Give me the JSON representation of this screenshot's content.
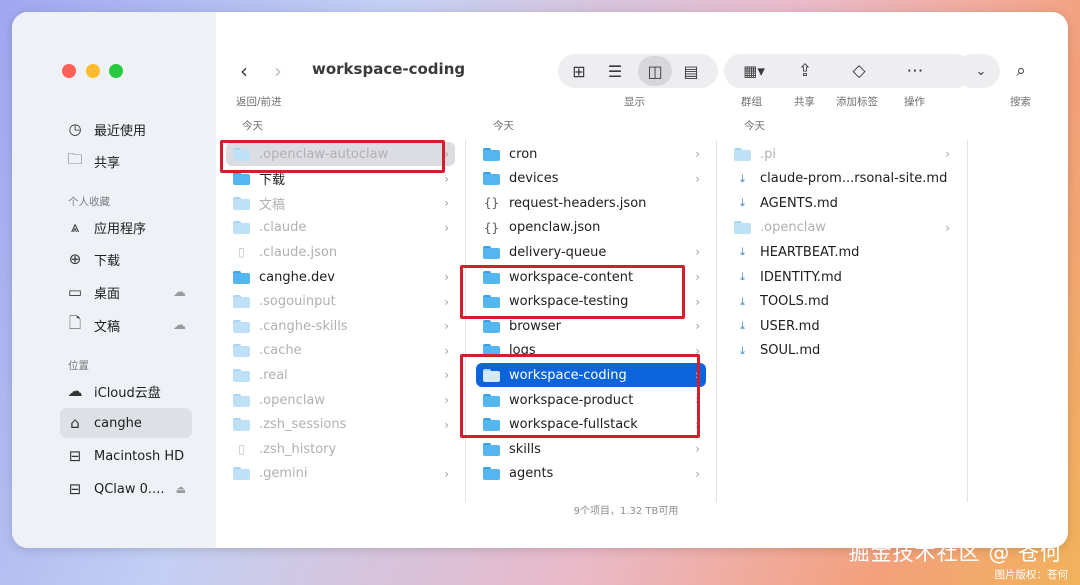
{
  "window": {
    "title": "workspace-coding"
  },
  "toolbar": {
    "back_forward_label": "返回/前进",
    "view_label": "显示",
    "group_label": "群组",
    "share_label": "共享",
    "tags_label": "添加标签",
    "action_label": "操作",
    "search_label": "搜索"
  },
  "sidebar": {
    "items": [
      {
        "label": "最近使用",
        "icon": "clock-icon"
      },
      {
        "label": "共享",
        "icon": "shared-folder-icon"
      }
    ],
    "favorites_header": "个人收藏",
    "favorites": [
      {
        "label": "应用程序",
        "icon": "applications-icon"
      },
      {
        "label": "下载",
        "icon": "download-icon"
      },
      {
        "label": "桌面",
        "icon": "desktop-icon",
        "cloud": true
      },
      {
        "label": "文稿",
        "icon": "document-icon",
        "cloud": true
      }
    ],
    "locations_header": "位置",
    "locations": [
      {
        "label": "iCloud云盘",
        "icon": "cloud-icon"
      },
      {
        "label": "canghe",
        "icon": "home-icon",
        "selected": true
      },
      {
        "label": "Macintosh HD",
        "icon": "disk-icon"
      },
      {
        "label": "QClaw 0....",
        "icon": "disk-icon",
        "eject": true
      }
    ]
  },
  "columns": [
    {
      "header": "今天",
      "rows": [
        {
          "name": ".openclaw-autoclaw",
          "type": "folder",
          "dim": true,
          "highlighted": true,
          "chevron": true
        },
        {
          "name": "下载",
          "type": "folder",
          "chevron": true
        },
        {
          "name": "文稿",
          "type": "folder",
          "dim": true,
          "chevron": true
        },
        {
          "name": ".claude",
          "type": "folder",
          "dim": true,
          "chevron": true
        },
        {
          "name": ".claude.json",
          "type": "file",
          "dim": true
        },
        {
          "name": "canghe.dev",
          "type": "folder",
          "chevron": true
        },
        {
          "name": ".sogouinput",
          "type": "folder",
          "dim": true,
          "chevron": true
        },
        {
          "name": ".canghe-skills",
          "type": "folder",
          "dim": true,
          "chevron": true
        },
        {
          "name": ".cache",
          "type": "folder",
          "dim": true,
          "chevron": true
        },
        {
          "name": ".real",
          "type": "folder",
          "dim": true,
          "chevron": true
        },
        {
          "name": ".openclaw",
          "type": "folder",
          "dim": true,
          "chevron": true
        },
        {
          "name": ".zsh_sessions",
          "type": "folder",
          "dim": true,
          "chevron": true
        },
        {
          "name": ".zsh_history",
          "type": "file",
          "dim": true
        },
        {
          "name": ".gemini",
          "type": "folder",
          "dim": true,
          "chevron": true
        }
      ]
    },
    {
      "header": "今天",
      "rows": [
        {
          "name": "cron",
          "type": "folder",
          "chevron": true
        },
        {
          "name": "devices",
          "type": "folder",
          "chevron": true
        },
        {
          "name": "request-headers.json",
          "type": "json"
        },
        {
          "name": "openclaw.json",
          "type": "json"
        },
        {
          "name": "delivery-queue",
          "type": "folder",
          "chevron": true
        },
        {
          "name": "workspace-content",
          "type": "folder",
          "chevron": true
        },
        {
          "name": "workspace-testing",
          "type": "folder",
          "chevron": true
        },
        {
          "name": "browser",
          "type": "folder",
          "chevron": true
        },
        {
          "name": "logs",
          "type": "folder",
          "chevron": true
        },
        {
          "name": "workspace-coding",
          "type": "folder",
          "selected": true,
          "chevron": true
        },
        {
          "name": "workspace-product",
          "type": "folder",
          "chevron": true
        },
        {
          "name": "workspace-fullstack",
          "type": "folder",
          "chevron": true
        },
        {
          "name": "skills",
          "type": "folder",
          "chevron": true
        },
        {
          "name": "agents",
          "type": "folder",
          "chevron": true
        }
      ]
    },
    {
      "header": "今天",
      "rows": [
        {
          "name": ".pi",
          "type": "folder",
          "dim": true,
          "chevron": true
        },
        {
          "name": "claude-prom...rsonal-site.md",
          "type": "md"
        },
        {
          "name": "AGENTS.md",
          "type": "md"
        },
        {
          "name": ".openclaw",
          "type": "folder",
          "dim": true,
          "chevron": true
        },
        {
          "name": "HEARTBEAT.md",
          "type": "md"
        },
        {
          "name": "IDENTITY.md",
          "type": "md"
        },
        {
          "name": "TOOLS.md",
          "type": "md"
        },
        {
          "name": "USER.md",
          "type": "md"
        },
        {
          "name": "SOUL.md",
          "type": "md"
        }
      ]
    }
  ],
  "status": "9个项目，1.32 TB可用",
  "watermark": {
    "main": "掘金技术社区 @ 苍何",
    "sub": "图片版权：苍何"
  }
}
